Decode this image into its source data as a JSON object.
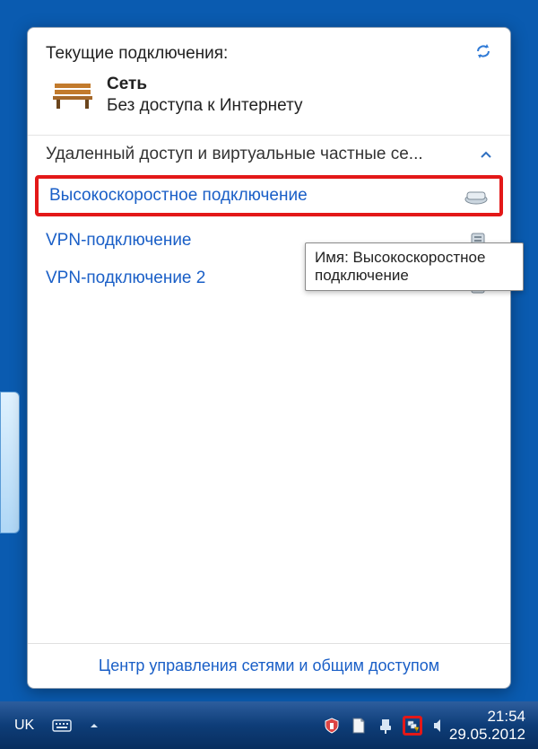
{
  "header": {
    "title": "Текущие подключения:"
  },
  "network": {
    "name": "Сеть",
    "status": "Без доступа к Интернету"
  },
  "section": {
    "title": "Удаленный доступ и виртуальные частные се..."
  },
  "connections": [
    {
      "label": "Высокоскоростное подключение",
      "icon": "modem",
      "highlight": true
    },
    {
      "label": "VPN-подключение",
      "icon": "server",
      "highlight": false
    },
    {
      "label": "VPN-подключение 2",
      "icon": "server",
      "highlight": false
    }
  ],
  "tooltip": {
    "text": "Имя: Высокоскоростное подключение"
  },
  "footer": {
    "link": "Центр управления сетями и общим доступом"
  },
  "taskbar": {
    "language": "UK",
    "time": "21:54",
    "date": "29.05.2012"
  }
}
